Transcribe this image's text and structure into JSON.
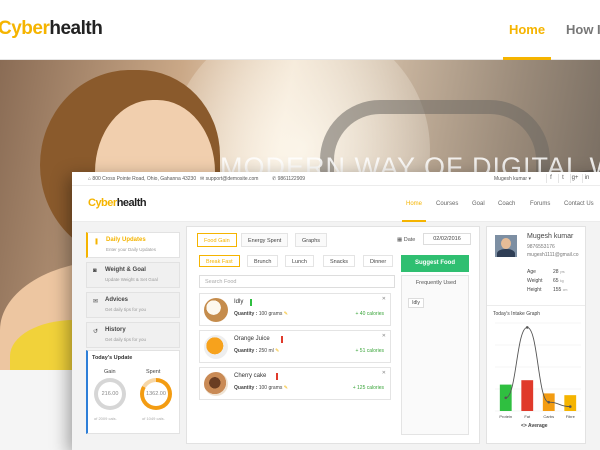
{
  "site": {
    "brand_a": "Cyber",
    "brand_b": "health",
    "nav": [
      "Home",
      "How It"
    ],
    "active_nav": "Home",
    "hero_text": "MODERN WAY OF DIGITAL WEI"
  },
  "infobar": {
    "address": "800 Cross Pointe Road, Ohio, Gahanna 43230",
    "email": "support@demosite.com",
    "phone": "9861122909",
    "user": "Mugesh kumar ▾",
    "social_icons": [
      "facebook-icon",
      "twitter-icon",
      "google-plus-icon",
      "linkedin-icon"
    ],
    "social_glyphs": [
      "f",
      "t",
      "g+",
      "in"
    ]
  },
  "app": {
    "brand_a": "Cyber",
    "brand_b": "health",
    "nav": [
      "Home",
      "Courses",
      "Goal",
      "Coach",
      "Forums",
      "Contact Us"
    ]
  },
  "sidebar": {
    "items": [
      {
        "title": "Daily Updates",
        "sub": "Enter your Daily Updates",
        "icon": "bookmark-icon",
        "glyph": "❚"
      },
      {
        "title": "Weight & Goal",
        "sub": "Update Weight & Set Goal",
        "icon": "scale-icon",
        "glyph": "◙"
      },
      {
        "title": "Advices",
        "sub": "Get daily tips for you",
        "icon": "chat-icon",
        "glyph": "✉"
      },
      {
        "title": "History",
        "sub": "Get daily tips for you",
        "icon": "history-icon",
        "glyph": "↺"
      }
    ],
    "today": {
      "title": "Today's Update",
      "gain_label": "Gain",
      "gain_value": "216.00",
      "gain_total": "of 2009 cals.",
      "spent_label": "Spent",
      "spent_value": "1362.00",
      "spent_total": "of 1049 cals."
    }
  },
  "main": {
    "tabs": [
      "Food Gain",
      "Energy Spent",
      "Graphs"
    ],
    "date_label": "Date",
    "date_value": "02/02/2016",
    "meals": [
      "Break Fast",
      "Brunch",
      "Lunch",
      "Snacks",
      "Dinner"
    ],
    "search_placeholder": "Search Food",
    "suggest_button": "Suggest Food",
    "frequent_title": "Frequently Used",
    "frequent_items": [
      "Idly"
    ],
    "foods": [
      {
        "name": "Idly",
        "qty_label": "Quantity :",
        "qty": "100 grams",
        "calories": "+ 40 calories",
        "flag_color": "#2fbf40"
      },
      {
        "name": "Orange Juice",
        "qty_label": "Quantity :",
        "qty": "250 ml",
        "calories": "+ 51 calories",
        "flag_color": "#e03a2b"
      },
      {
        "name": "Cherry cake",
        "qty_label": "Quantity :",
        "qty": "100 grams",
        "calories": "+ 125 calories",
        "flag_color": "#e03a2b"
      }
    ]
  },
  "profile": {
    "name": "Mugesh kumar",
    "phone": "9876553176",
    "email": "mugesh1111@gmail.co",
    "stats": [
      {
        "key": "Age",
        "value": "28",
        "unit": "yrs"
      },
      {
        "key": "Weight",
        "value": "65",
        "unit": "kg"
      },
      {
        "key": "Height",
        "value": "155",
        "unit": "cm"
      }
    ],
    "intake_title": "Today's Intake Graph",
    "avg_label": "<> Average"
  },
  "chart_data": {
    "type": "bar",
    "title": "Today's Intake Graph",
    "categories": [
      "Protein",
      "Fat",
      "Carbs",
      "Fibre"
    ],
    "values": [
      30,
      35,
      20,
      18
    ],
    "colors": [
      "#2fbf40",
      "#e03a2b",
      "#f39c12",
      "#f5b400"
    ],
    "line_values": [
      15,
      95,
      10,
      5
    ],
    "ylim": [
      0,
      100
    ],
    "grid": true
  },
  "colors": {
    "accent": "#f5b400",
    "success": "#2fbf71",
    "danger": "#e03a2b",
    "info": "#2e7fd8"
  }
}
